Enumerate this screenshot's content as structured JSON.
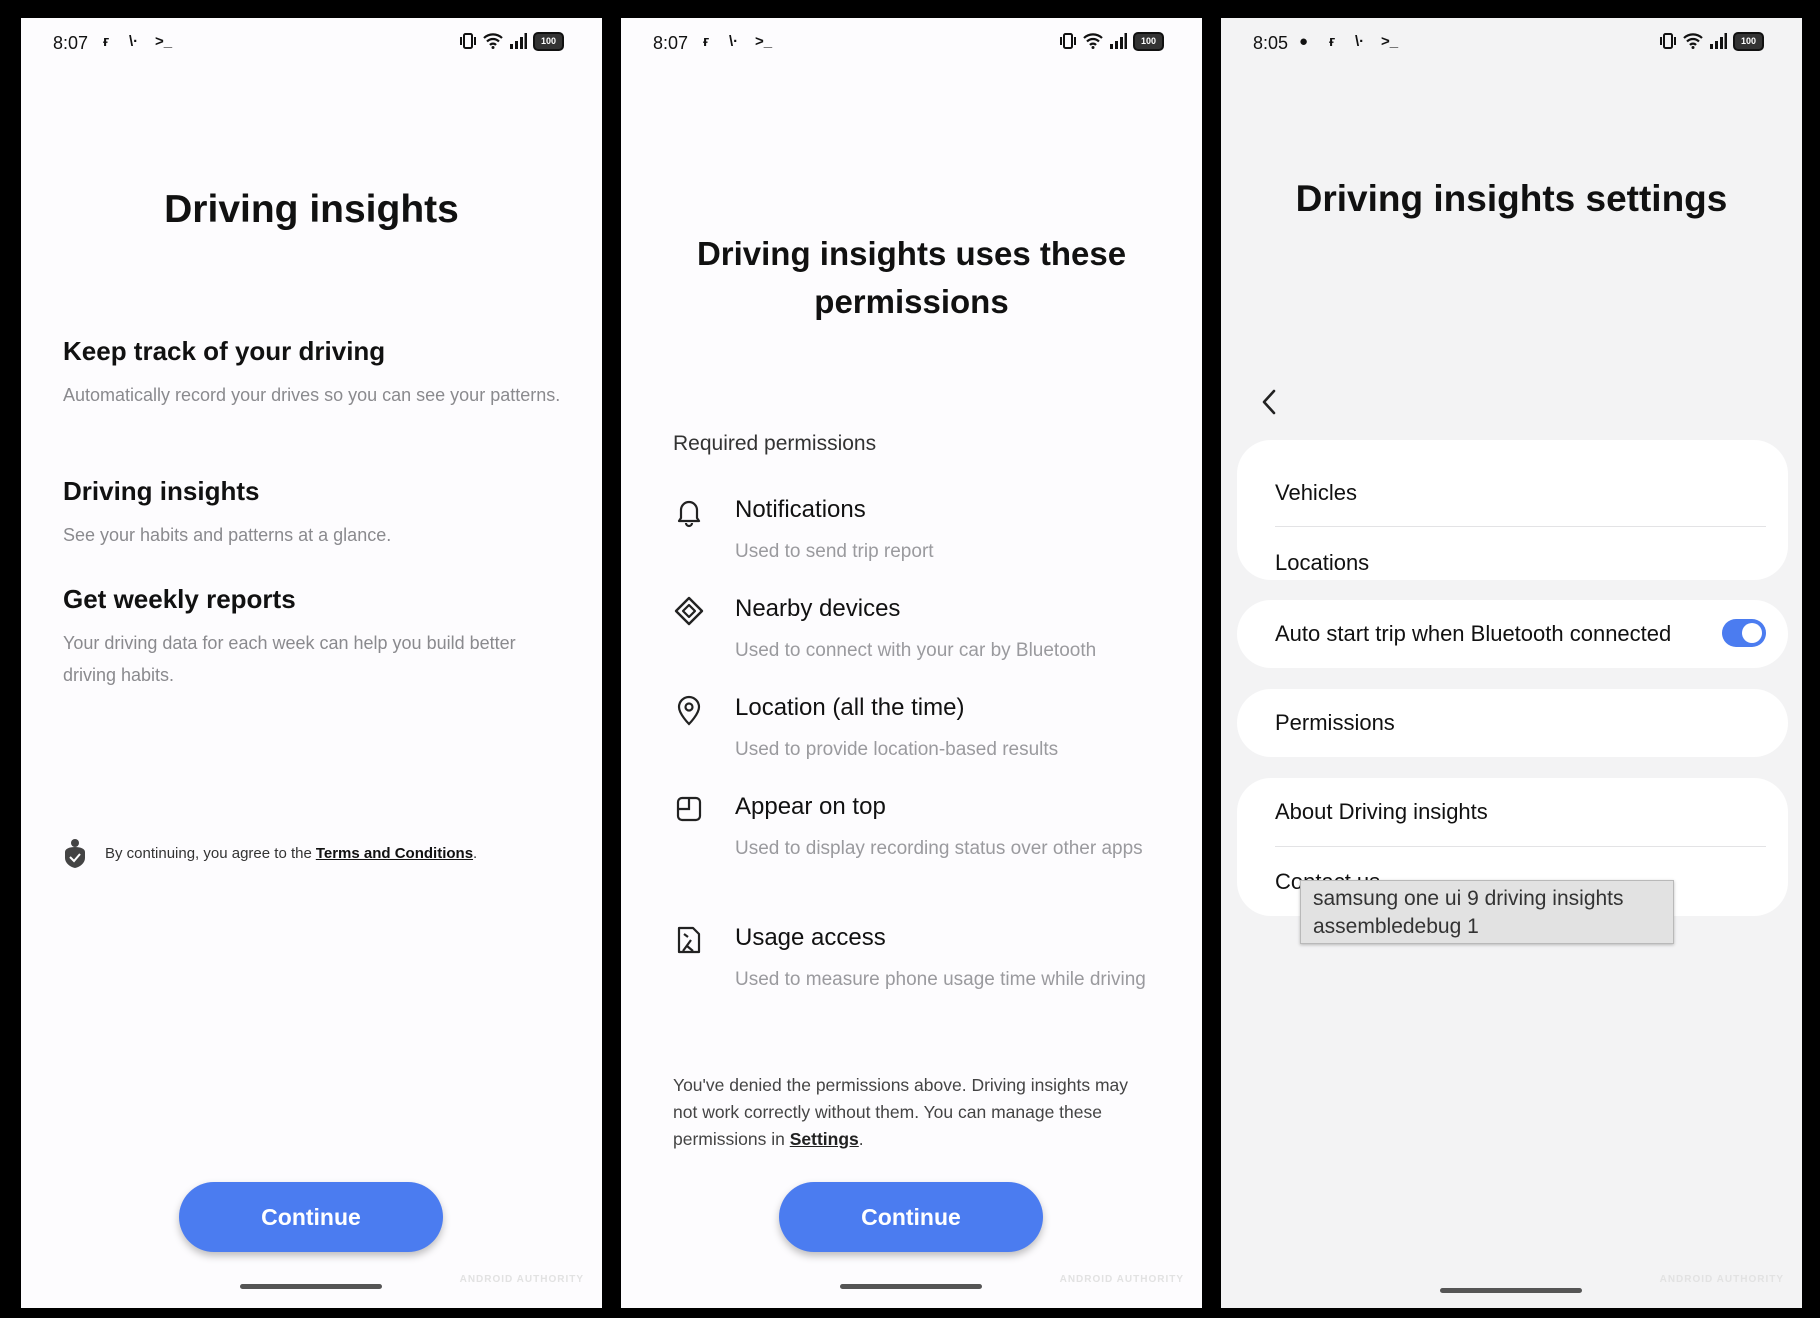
{
  "screen1": {
    "status": {
      "time": "8:07",
      "battery": "100"
    },
    "title": "Driving insights",
    "features": [
      {
        "title": "Keep track of your driving",
        "desc": "Automatically record your drives so you can see your patterns."
      },
      {
        "title": "Driving insights",
        "desc": "See your habits and patterns at a glance."
      },
      {
        "title": "Get weekly reports",
        "desc": "Your driving data for each week can help you build better driving habits."
      }
    ],
    "consent": {
      "text": "By continuing, you agree to the",
      "link": "Terms and Conditions",
      "after": "."
    },
    "continue_label": "Continue",
    "watermark": "ANDROID AUTHORITY"
  },
  "screen2": {
    "status": {
      "time": "8:07",
      "battery": "100"
    },
    "title": "Driving insights uses these permissions",
    "required_label": "Required permissions",
    "permissions": [
      {
        "icon": "bell-icon",
        "title": "Notifications",
        "desc": "Used to send trip report"
      },
      {
        "icon": "nearby-devices-icon",
        "title": "Nearby devices",
        "desc": "Used to connect with your car by Bluetooth"
      },
      {
        "icon": "location-pin-icon",
        "title": "Location (all the time)",
        "desc": "Used to provide location-based results"
      },
      {
        "icon": "appear-on-top-icon",
        "title": "Appear on top",
        "desc": "Used to display recording status over other apps"
      },
      {
        "icon": "usage-access-icon",
        "title": "Usage access",
        "desc": "Used to measure phone usage time while driving"
      }
    ],
    "denied_text": "You've denied the permissions above. Driving insights may not work correctly without them. You can manage these permissions in",
    "settings_link": "Settings",
    "denied_after": ".",
    "continue_label": "Continue",
    "watermark": "ANDROID AUTHORITY"
  },
  "screen3": {
    "status": {
      "time": "8:05",
      "battery": "100"
    },
    "title": "Driving insights settings",
    "items": {
      "vehicles": "Vehicles",
      "locations": "Locations",
      "auto_start": "Auto start trip when Bluetooth connected",
      "auto_start_enabled": true,
      "permissions": "Permissions",
      "about": "About Driving insights",
      "contact": "Contact us"
    },
    "tooltip": "samsung one ui 9 driving insights\nassembledebug 1",
    "watermark": "ANDROID AUTHORITY"
  },
  "colors": {
    "accent": "#4b7cf0",
    "phone_bg": "#fdfcfe",
    "settings_bg": "#f3f3f4"
  }
}
